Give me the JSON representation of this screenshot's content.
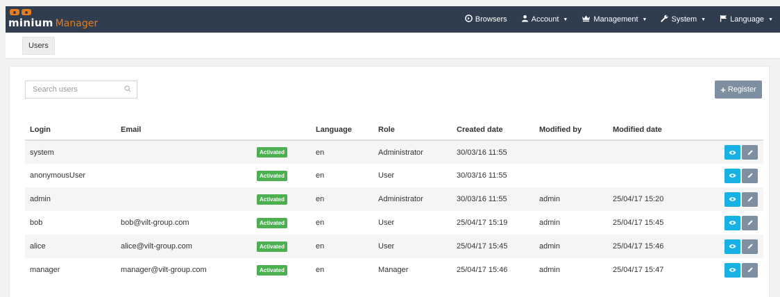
{
  "app": {
    "brand": "minium",
    "brand_sub": "Manager"
  },
  "nav": [
    {
      "label": "Browsers",
      "icon": "circle-arrow-icon",
      "dropdown": false
    },
    {
      "label": "Account",
      "icon": "user-icon",
      "dropdown": true
    },
    {
      "label": "Management",
      "icon": "crown-icon",
      "dropdown": true
    },
    {
      "label": "System",
      "icon": "wrench-icon",
      "dropdown": true
    },
    {
      "label": "Language",
      "icon": "flag-icon",
      "dropdown": true
    }
  ],
  "breadcrumb": {
    "current": "Users"
  },
  "search": {
    "placeholder": "Search users",
    "value": ""
  },
  "register_label": "Register",
  "table": {
    "headers": [
      "Login",
      "Email",
      "",
      "Language",
      "Role",
      "Created date",
      "Modified by",
      "Modified date",
      ""
    ],
    "rows": [
      {
        "login": "system",
        "email": "",
        "status": "Activated",
        "language": "en",
        "role": "Administrator",
        "created": "30/03/16 11:55",
        "modified_by": "",
        "modified": ""
      },
      {
        "login": "anonymousUser",
        "email": "",
        "status": "Activated",
        "language": "en",
        "role": "User",
        "created": "30/03/16 11:55",
        "modified_by": "",
        "modified": ""
      },
      {
        "login": "admin",
        "email": "",
        "status": "Activated",
        "language": "en",
        "role": "Administrator",
        "created": "30/03/16 11:55",
        "modified_by": "admin",
        "modified": "25/04/17 15:20"
      },
      {
        "login": "bob",
        "email": "bob@vilt-group.com",
        "status": "Activated",
        "language": "en",
        "role": "User",
        "created": "25/04/17 15:19",
        "modified_by": "admin",
        "modified": "25/04/17 15:45"
      },
      {
        "login": "alice",
        "email": "alice@vilt-group.com",
        "status": "Activated",
        "language": "en",
        "role": "User",
        "created": "25/04/17 15:45",
        "modified_by": "admin",
        "modified": "25/04/17 15:46"
      },
      {
        "login": "manager",
        "email": "manager@vilt-group.com",
        "status": "Activated",
        "language": "en",
        "role": "Manager",
        "created": "25/04/17 15:46",
        "modified_by": "admin",
        "modified": "25/04/17 15:47"
      }
    ]
  },
  "colors": {
    "navbar": "#2f3d4f",
    "brand_orange": "#e87b1e",
    "badge_green": "#4caf50",
    "view_blue": "#17b1e3",
    "edit_gray": "#7d8fa0"
  }
}
